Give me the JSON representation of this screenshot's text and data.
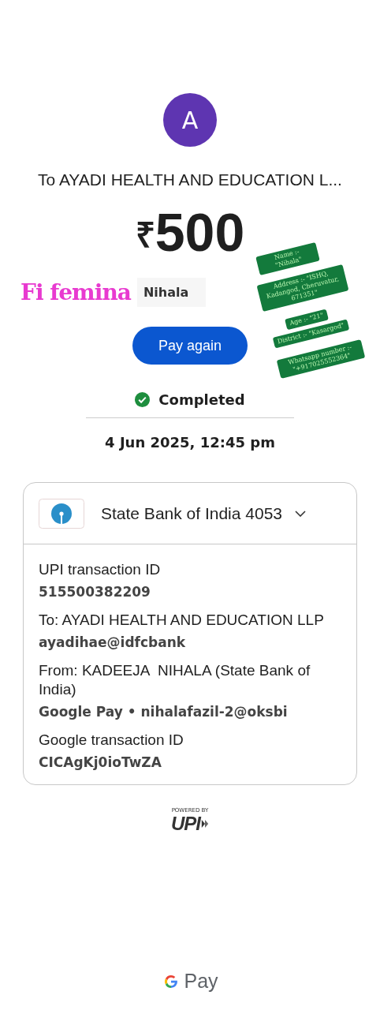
{
  "avatar": {
    "initial": "A"
  },
  "recipient_title": "To AYADI HEALTH AND EDUCATION L...",
  "amount": {
    "currency": "₹",
    "value": "500"
  },
  "overlay_caption": "Fi femina",
  "overlay_name": "Nihala",
  "overlay_tags": [
    {
      "text": "Name :- \"Nihala\""
    },
    {
      "text": "Address :- \"ISHQ, Kadangod, Cheruvatur, 671351\""
    },
    {
      "text": "Age :- \"21\""
    },
    {
      "text": "District :- \"Kasargod\""
    },
    {
      "text": "Whatsapp number :- \"+917025552364\""
    }
  ],
  "pay_again_button": "Pay again",
  "status": {
    "kind": "completed",
    "label": "Completed"
  },
  "date": "4 Jun 2025, 12:45 pm",
  "details_card": {
    "bank": "State Bank of India 4053",
    "expanded": true,
    "fields": [
      {
        "label": "UPI transaction ID",
        "value": "515500382209"
      },
      {
        "label": "To: AYADI HEALTH AND EDUCATION LLP",
        "value": "ayadihae@idfcbank"
      },
      {
        "label": "From: KADEEJA  NIHALA (State Bank of India)",
        "value": "Google Pay • nihalafazil-2@oksbi"
      },
      {
        "label": "Google transaction ID",
        "value": "CICAgKj0ioTwZA"
      }
    ]
  },
  "powered_by": {
    "caption": "POWERED BY",
    "logo": "UPI"
  },
  "footer_brand": "Pay"
}
